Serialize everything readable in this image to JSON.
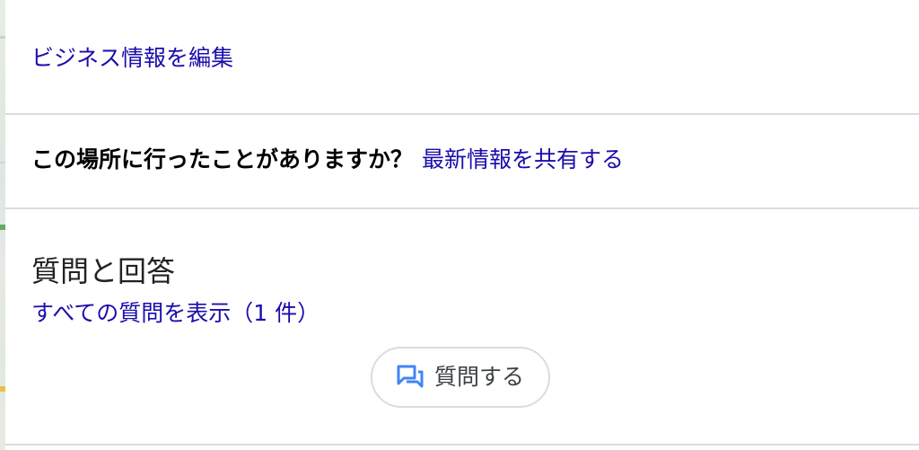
{
  "business": {
    "edit_label": "ビジネス情報を編集"
  },
  "visit_prompt": {
    "question": "この場所に行ったことがありますか？",
    "share_label": "最新情報を共有する"
  },
  "qa": {
    "title": "質問と回答",
    "view_all_label": "すべての質問を表示（1 件）",
    "ask_button_label": "質問する",
    "ask_icon": "forum-icon"
  },
  "colors": {
    "link": "#1a0dab",
    "divider": "#dadce0",
    "icon_blue": "#4285f4"
  }
}
